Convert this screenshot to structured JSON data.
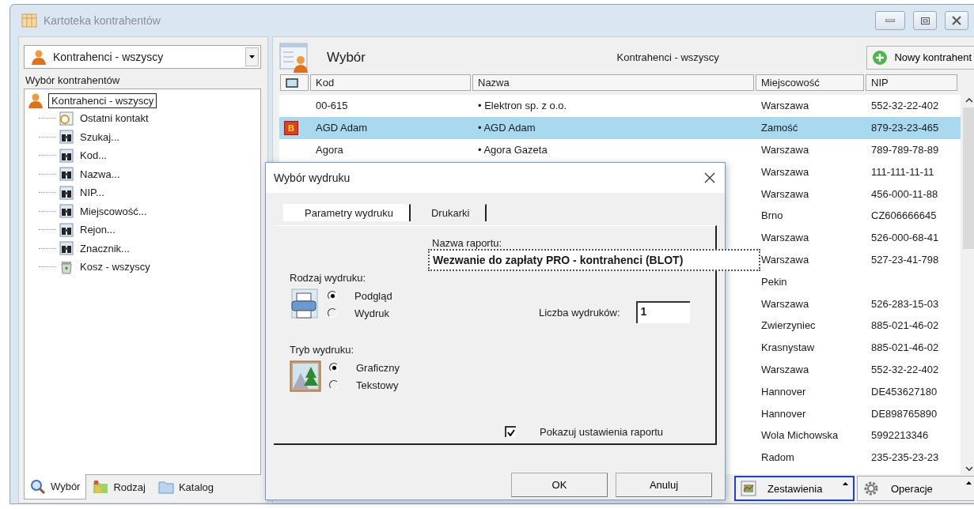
{
  "window": {
    "title": "Kartoteka kontrahentów"
  },
  "left": {
    "combo": {
      "value": "Kontrahenci - wszyscy"
    },
    "section_label": "Wybór kontrahentów",
    "tree": {
      "label": "Kontrahenci - wszyscy",
      "selected": true,
      "children": [
        {
          "label": "Ostatni kontakt",
          "kind": "recent"
        },
        {
          "label": "Szukaj...",
          "kind": "search"
        },
        {
          "label": "Kod...",
          "kind": "search"
        },
        {
          "label": "Nazwa...",
          "kind": "search"
        },
        {
          "label": "NIP...",
          "kind": "search"
        },
        {
          "label": "Miejscowość...",
          "kind": "search"
        },
        {
          "label": "Rejon...",
          "kind": "search"
        },
        {
          "label": "Znacznik...",
          "kind": "search"
        },
        {
          "label": "Kosz - wszyscy",
          "kind": "trash"
        }
      ]
    },
    "tabs": [
      {
        "label": "Wybór",
        "kind": "search",
        "selected": true
      },
      {
        "label": "Rodzaj",
        "kind": "types",
        "selected": false
      },
      {
        "label": "Katalog",
        "kind": "folder",
        "selected": false
      }
    ]
  },
  "right": {
    "header": {
      "title": "Wybór",
      "subtitle": "Kontrahenci - wszyscy",
      "new_button": "Nowy kontrahent"
    },
    "table": {
      "columns": [
        "Kod",
        "Nazwa",
        "Miejscowość",
        "NIP"
      ],
      "rows": [
        {
          "kod": "00-615",
          "nazwa": "• Elektron sp. z o.o.",
          "miejscowosc": "Warszawa",
          "nip": "552-32-22-402",
          "selected": false
        },
        {
          "badge": "B",
          "kod": "AGD Adam",
          "nazwa": "• AGD Adam",
          "miejscowosc": "Zamość",
          "nip": "879-23-23-465",
          "selected": true
        },
        {
          "kod": "Agora",
          "nazwa": "• Agora Gazeta",
          "miejscowosc": "Warszawa",
          "nip": "789-789-78-89",
          "selected": false
        },
        {
          "miejscowosc": "Warszawa",
          "nip": "111-111-11-11",
          "selected": false
        },
        {
          "miejscowosc": "Warszawa",
          "nip": "456-000-11-88",
          "selected": false
        },
        {
          "miejscowosc": "Brno",
          "nip": "CZ606666645",
          "selected": false
        },
        {
          "miejscowosc": "Warszawa",
          "nip": "526-000-68-41",
          "selected": false
        },
        {
          "miejscowosc": "Warszawa",
          "nip": "527-23-41-798",
          "selected": false
        },
        {
          "miejscowosc": "Pekin",
          "selected": false
        },
        {
          "miejscowosc": "Warszawa",
          "nip": "526-283-15-03",
          "selected": false
        },
        {
          "miejscowosc": "Zwierzyniec",
          "nip": "885-021-46-02",
          "selected": false
        },
        {
          "miejscowosc": "Krasnystaw",
          "nip": "885-021-46-02",
          "selected": false
        },
        {
          "miejscowosc": "Warszawa",
          "nip": "552-32-22-402",
          "selected": false
        },
        {
          "miejscowosc": "Hannover",
          "nip": "DE453627180",
          "selected": false
        },
        {
          "miejscowosc": "Hannover",
          "nip": "DE898765890",
          "selected": false
        },
        {
          "miejscowosc": "Wola Michowska",
          "nip": "5992213346",
          "selected": false
        },
        {
          "miejscowosc": "Radom",
          "nip": "235-235-23-23",
          "selected": false
        }
      ]
    },
    "bottom_buttons": [
      {
        "label": "Zestawienia",
        "kind": "chart",
        "focused": true
      },
      {
        "label": "Operacje",
        "kind": "gear",
        "focused": false
      }
    ]
  },
  "dialog": {
    "title": "Wybór wydruku",
    "tabs": [
      {
        "label": "Parametry wydruku",
        "selected": true
      },
      {
        "label": "Drukarki",
        "selected": false
      }
    ],
    "report_name": {
      "label": "Nazwa raportu:",
      "value": "Wezwanie do zapłaty PRO - kontrahenci (BLOT)"
    },
    "print_type": {
      "label": "Rodzaj wydruku:",
      "options": [
        {
          "label": "Podgląd",
          "selected": true
        },
        {
          "label": "Wydruk",
          "selected": false
        }
      ]
    },
    "copies": {
      "label": "Liczba wydruków:",
      "value": "1"
    },
    "print_mode": {
      "label": "Tryb wydruku:",
      "options": [
        {
          "label": "Graficzny",
          "selected": true
        },
        {
          "label": "Tekstowy",
          "selected": false
        }
      ]
    },
    "show_settings": {
      "label": "Pokazuj ustawienia raportu",
      "checked": true
    },
    "buttons": [
      "OK",
      "Anuluj"
    ]
  }
}
